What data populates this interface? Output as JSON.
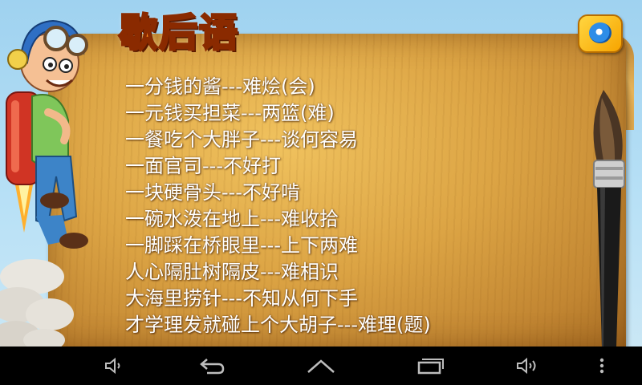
{
  "app": {
    "title": "歇后语",
    "logo_icon": "app-logo-icon"
  },
  "proverbs": [
    "一分钱的酱---难烩(会)",
    "一元钱买担菜---两篮(难)",
    "一餐吃个大胖子---谈何容易",
    "一面官司---不好打",
    "一块硬骨头---不好啃",
    "一碗水泼在地上---难收拾",
    "一脚踩在桥眼里---上下两难",
    "人心隔肚树隔皮---难相识",
    "大海里捞针---不知从何下手",
    "才学理发就碰上个大胡子---难理(题)"
  ],
  "navbar": {
    "buttons": [
      {
        "name": "volume-down-icon"
      },
      {
        "name": "back-icon"
      },
      {
        "name": "home-icon"
      },
      {
        "name": "recent-apps-icon"
      },
      {
        "name": "volume-up-icon"
      },
      {
        "name": "menu-icon"
      }
    ]
  },
  "colors": {
    "title_fill": "#ff8a1e",
    "title_outline": "#8a2a00",
    "board": "#dca444",
    "text": "#ffffff",
    "sky": "#b9e1f6",
    "navbar": "#000000"
  }
}
